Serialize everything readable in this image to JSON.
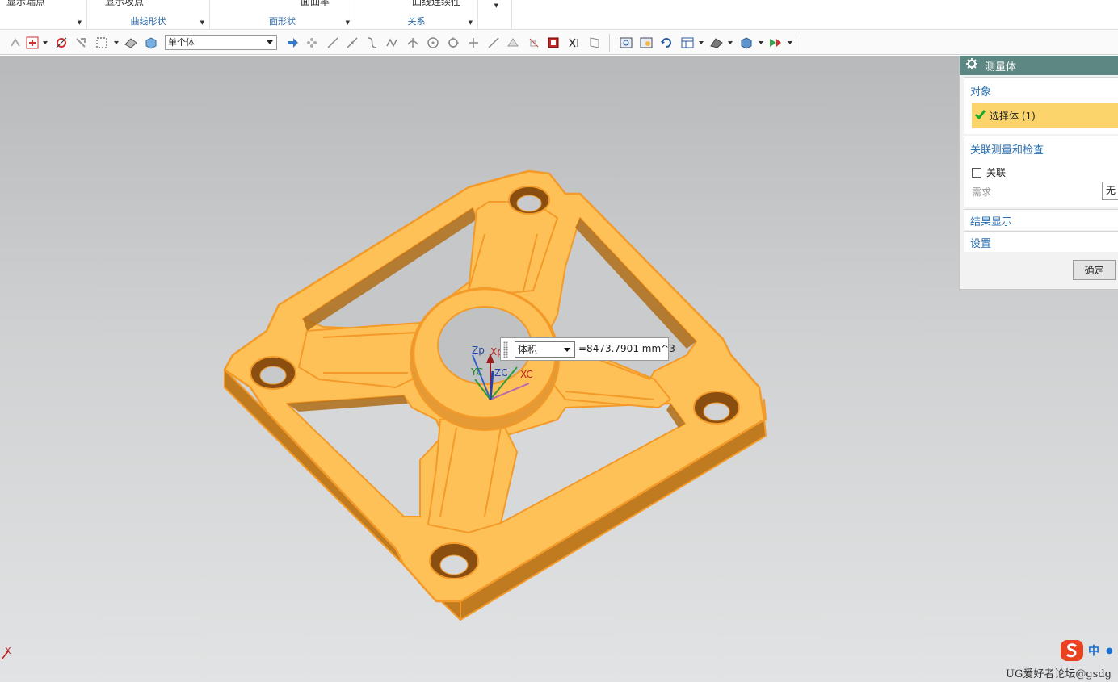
{
  "ribbon": {
    "groups": [
      {
        "cut_label": "显示端点",
        "label": ""
      },
      {
        "cut_label": "显示坂点",
        "label": "曲线形状"
      },
      {
        "cut_label": "面曲率",
        "label": "面形状"
      },
      {
        "cut_label": "曲线连续性",
        "label": "关系"
      }
    ]
  },
  "toolbar": {
    "selection_filter": "单个体"
  },
  "viewport": {
    "triad_labels": {
      "zp": "Zp",
      "xp": "Xp",
      "yc": "YC",
      "zc": "ZC",
      "xc": "XC"
    },
    "callout": {
      "measure_type": "体积",
      "value": "=8473.7901 mm^3"
    },
    "wcs_label": "X"
  },
  "dialog": {
    "title": "测量体",
    "sections": {
      "object": {
        "title": "对象",
        "select_body": "选择体 (1)"
      },
      "assoc": {
        "title": "关联测量和检查",
        "associative_label": "关联",
        "requirement_label": "需求",
        "requirement_value": "无"
      },
      "results": {
        "title": "结果显示"
      },
      "settings": {
        "title": "设置"
      }
    },
    "ok_label": "确定"
  },
  "status": {
    "ime_lang": "中",
    "watermark": "UG爱好者论坛@gsdg"
  },
  "colors": {
    "part_fill": "#fec158",
    "part_edge": "#f39a28",
    "dialog_header": "#5c8783",
    "selected_row": "#fbd56b",
    "section_title": "#2a6fb1"
  }
}
